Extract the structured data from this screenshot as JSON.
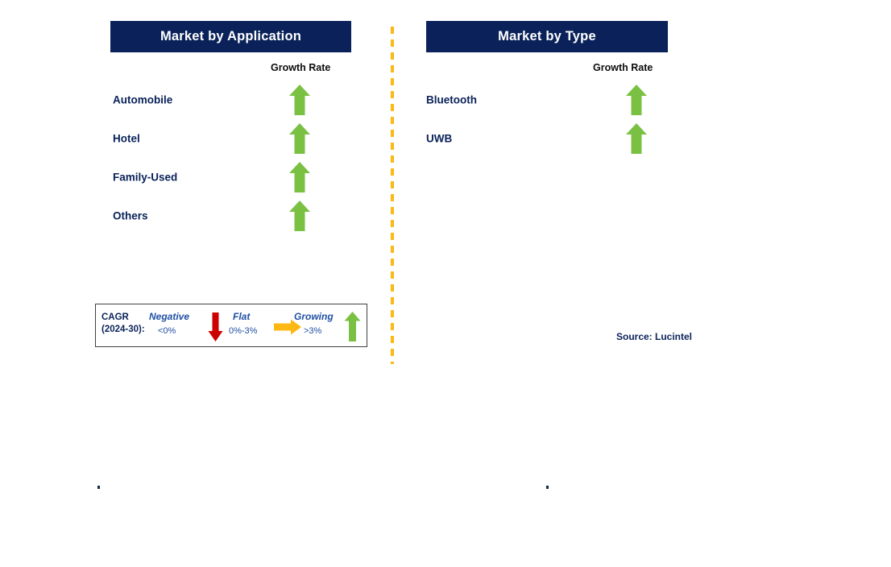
{
  "panels": [
    {
      "id": "application",
      "title": "Market by Application",
      "growth_caption": "Growth Rate",
      "rows": [
        {
          "label": "Automobile",
          "growth": "growing",
          "arrow_icon": "arrow-up-icon"
        },
        {
          "label": "Hotel",
          "growth": "growing",
          "arrow_icon": "arrow-up-icon"
        },
        {
          "label": "Family-Used",
          "growth": "growing",
          "arrow_icon": "arrow-up-icon"
        },
        {
          "label": "Others",
          "growth": "growing",
          "arrow_icon": "arrow-up-icon"
        }
      ]
    },
    {
      "id": "type",
      "title": "Market by Type",
      "growth_caption": "Growth Rate",
      "rows": [
        {
          "label": "Bluetooth",
          "growth": "growing",
          "arrow_icon": "arrow-up-icon"
        },
        {
          "label": "UWB",
          "growth": "growing",
          "arrow_icon": "arrow-up-icon"
        }
      ]
    }
  ],
  "legend": {
    "title_line1": "CAGR",
    "title_line2": "(2024-30):",
    "items": [
      {
        "word": "Negative",
        "range": "<0%",
        "arrow_icon": "arrow-down-icon",
        "color": "#cc0000"
      },
      {
        "word": "Flat",
        "range": "0%-3%",
        "arrow_icon": "arrow-right-icon",
        "color": "#fdb813"
      },
      {
        "word": "Growing",
        "range": ">3%",
        "arrow_icon": "arrow-up-icon",
        "color": "#7ac143"
      }
    ]
  },
  "source": "Source: Lucintel",
  "colors": {
    "header_bar": "#0a2259",
    "label_text": "#0a2259",
    "growing_arrow": "#7ac143",
    "negative_arrow": "#cc0000",
    "flat_arrow": "#fdb813",
    "divider": "#fdb813",
    "legend_text": "#1f4fa3"
  }
}
